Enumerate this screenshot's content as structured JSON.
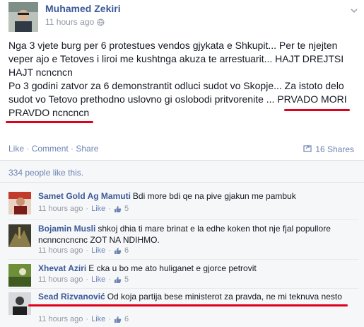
{
  "post": {
    "author": "Muhamed Zekiri",
    "time": "11 hours ago",
    "body": [
      "Nga 3 vjete burg per 6 protestues vendos gjykata e Shkupit... Per te njejten veper ajo e Tetoves i liroi me kushtnga akuza te arrestuarit... HAJT DREJTSI HAJT ncncncn",
      "Po 3 godini zatvor za 6 demonstrantit odluci sudot vo Skopje... Za istoto delo sudot vo Tetovo prethodno uslovno gi oslobodi pritvorenite ... PRVADO MORI PRAVDO ncncncn"
    ],
    "actions": {
      "like": "Like",
      "comment": "Comment",
      "share": "Share",
      "sep": " · "
    },
    "shares": "16 Shares",
    "likes_summary": "334 people like this."
  },
  "comments": [
    {
      "name": "Samet Gold Ag Mamuti",
      "text": "Bdi more bdi qe na pive gjakun me pambuk",
      "time": "11 hours ago",
      "like": "Like",
      "count": "5"
    },
    {
      "name": "Bojamin Musli",
      "text": "shkoj dhia ti mare brinat e la edhe koken thot nje fjal popullore ncnncncncnc ZOT NA NDIHMO.",
      "time": "11 hours ago",
      "like": "Like",
      "count": "6"
    },
    {
      "name": "Xhevat Aziri",
      "text": "E cka u bo me ato huliganet e gjorce petrovit",
      "time": "11 hours ago",
      "like": "Like",
      "count": "5"
    },
    {
      "name": "Sead Rizvanović",
      "text": "Od koja partija bese ministerot za pravda, ne mi teknuva nesto",
      "time": "11 hours ago",
      "like": "Like",
      "count": "6"
    }
  ],
  "colors": {
    "link": "#3b5998",
    "meta": "#9197a3",
    "annotation": "#e0001b"
  },
  "icons": [
    "globe-icon",
    "chevron-down-icon",
    "share-icon",
    "thumbs-up-icon"
  ]
}
